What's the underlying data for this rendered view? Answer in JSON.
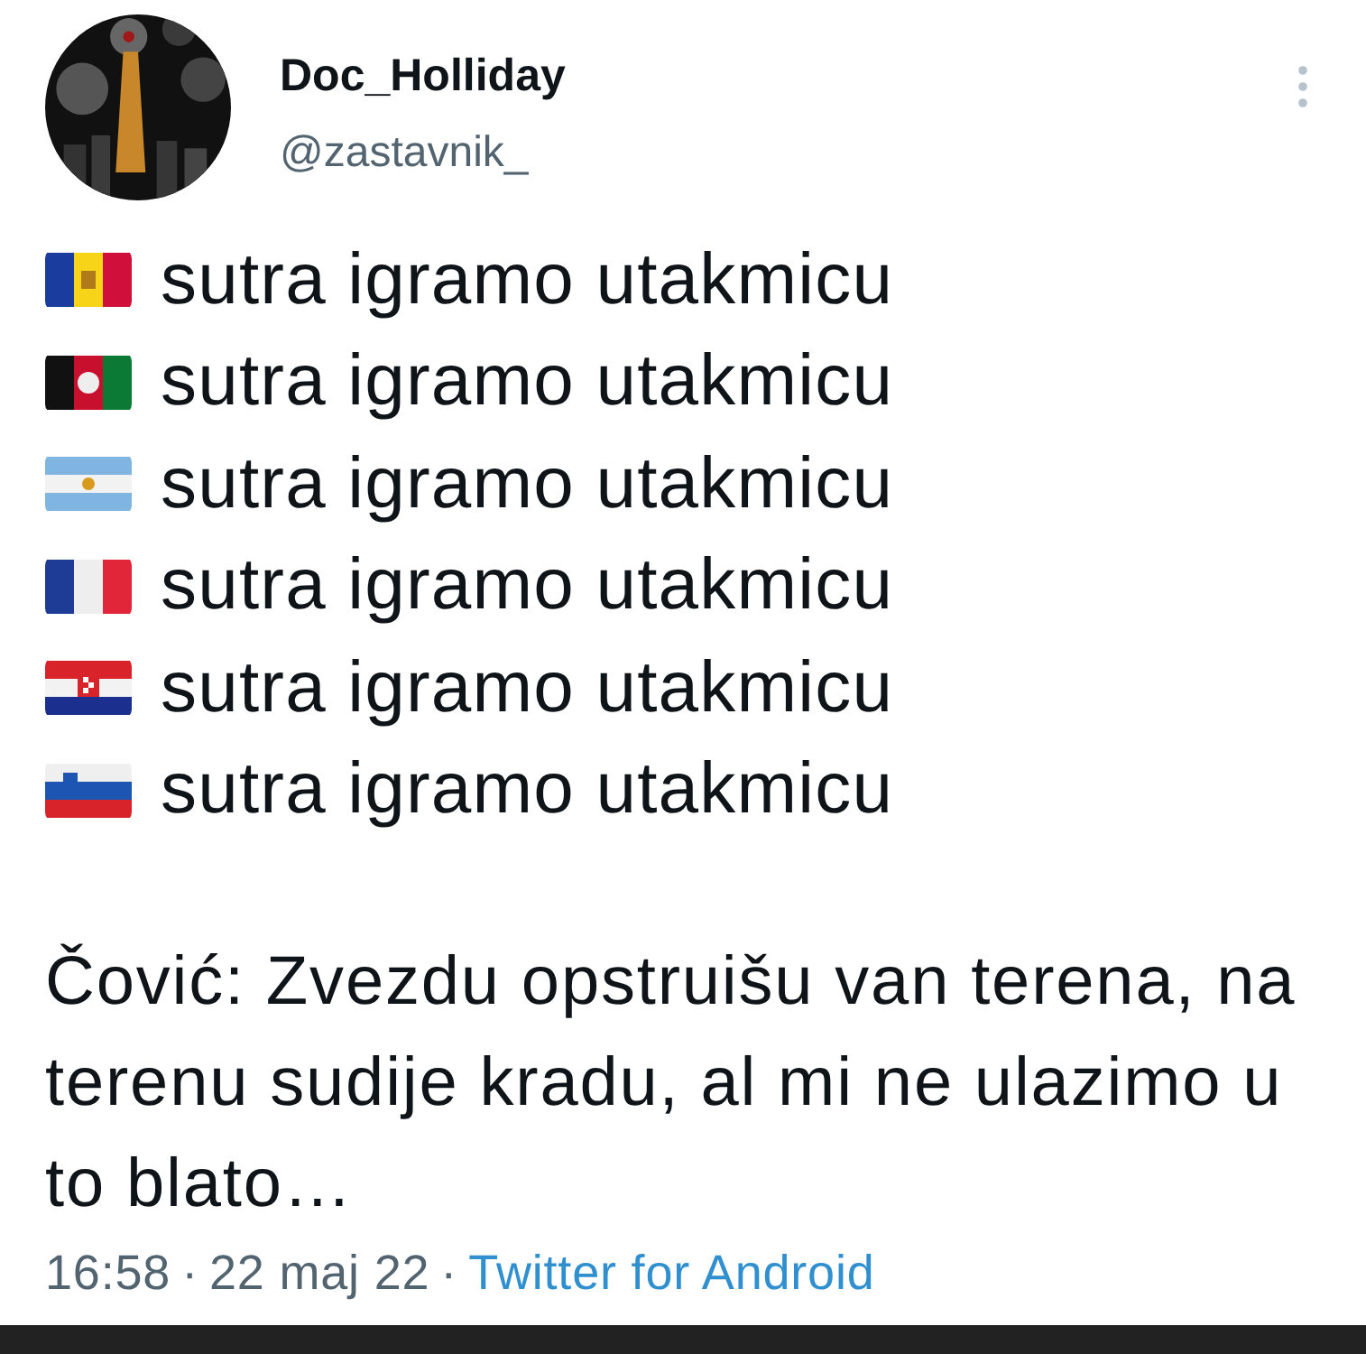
{
  "author": {
    "name": "Doc_Holliday",
    "handle": "@zastavnik_"
  },
  "lines": [
    {
      "kind": "andorra",
      "text": "sutra igramo utakmicu"
    },
    {
      "kind": "afghanistan",
      "text": "sutra igramo utakmicu"
    },
    {
      "kind": "argentina",
      "text": "sutra igramo utakmicu"
    },
    {
      "kind": "france",
      "text": "sutra igramo utakmicu"
    },
    {
      "kind": "croatia",
      "text": "sutra igramo utakmicu"
    },
    {
      "kind": "slovenia",
      "text": "sutra igramo utakmicu"
    }
  ],
  "quote": "Čović: Zvezdu opstruišu van terena, na terenu sudije kradu, al mi ne ulazimo u to blato…",
  "meta": {
    "time": "16:58",
    "separator_1": "·",
    "date": "22 maj 22",
    "separator_2": "·",
    "source": "Twitter for Android"
  }
}
